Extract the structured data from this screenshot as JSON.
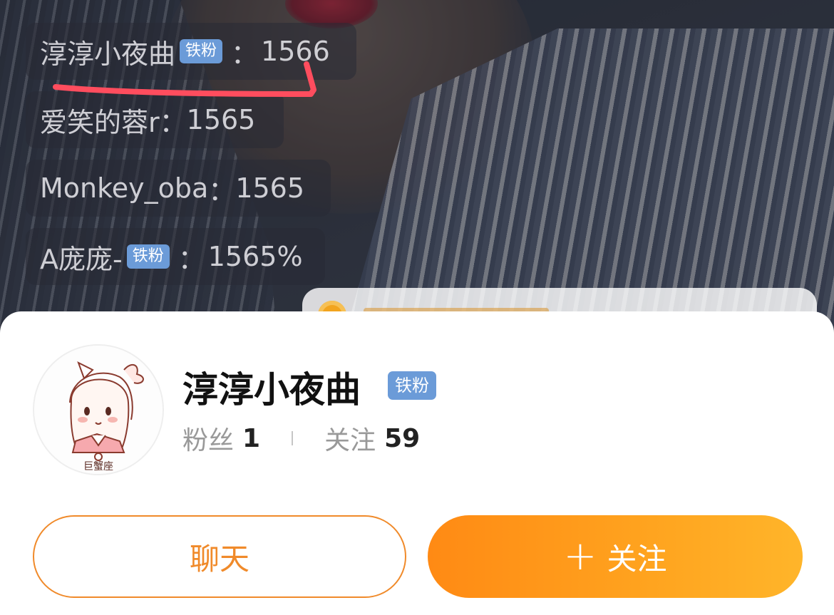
{
  "comments": [
    {
      "user": "淳淳小夜曲",
      "badge": "铁粉",
      "colon": "：",
      "value": "1566"
    },
    {
      "user": "爱笑的蓉r",
      "colon": "：",
      "value": "1565"
    },
    {
      "user": "Monkey_oba",
      "colon": "：",
      "value": "1565"
    },
    {
      "user": "A庞庞-",
      "badge": "铁粉",
      "colon": "：",
      "value": "1565%"
    }
  ],
  "profile": {
    "nickname": "淳淳小夜曲",
    "badge": "铁粉",
    "fans_label": "粉丝",
    "fans_count": "1",
    "following_label": "关注",
    "following_count": "59"
  },
  "buttons": {
    "chat_label": "聊天",
    "follow_plus": "+",
    "follow_label": "关注"
  },
  "colors": {
    "accent_orange": "#ff8a14",
    "badge_blue": "#6b9bd8",
    "annotation_red": "#ff4d5e"
  }
}
